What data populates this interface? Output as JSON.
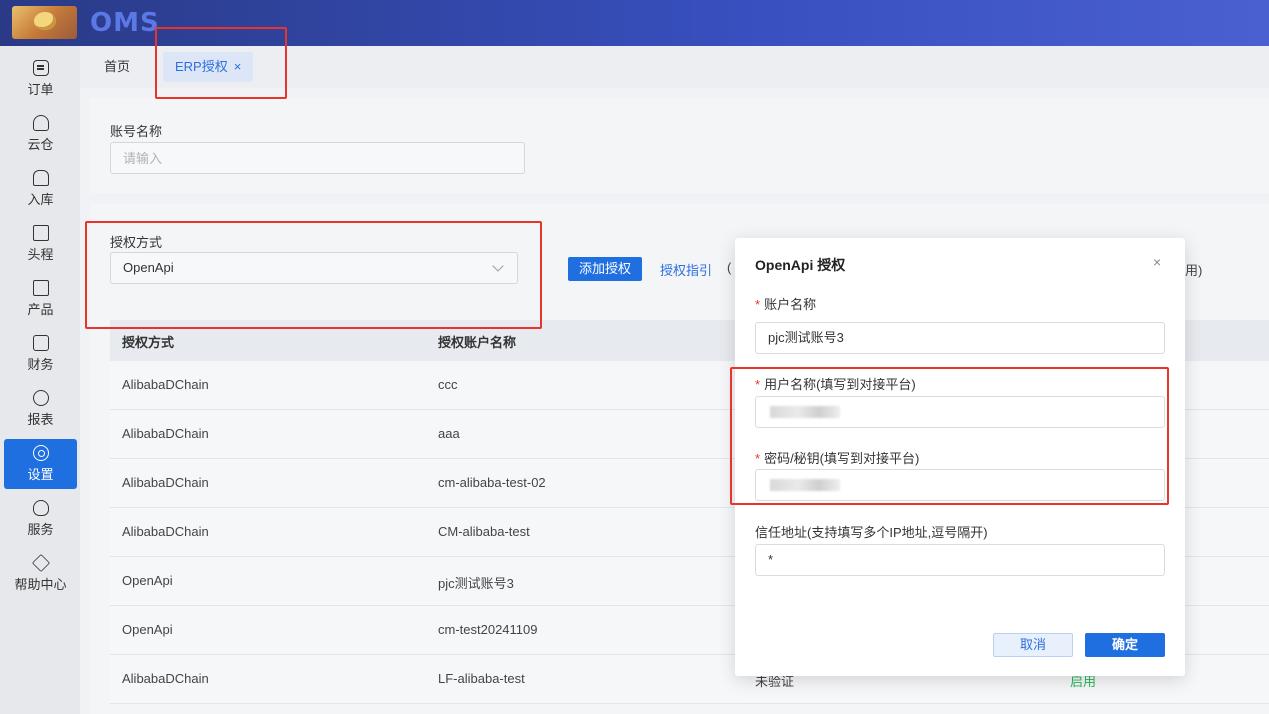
{
  "header": {
    "brand": "OMS"
  },
  "sidebar": {
    "items": [
      {
        "label": "订单",
        "icon": "order-icon"
      },
      {
        "label": "云仓",
        "icon": "cloud-warehouse-icon"
      },
      {
        "label": "入库",
        "icon": "inbound-icon"
      },
      {
        "label": "头程",
        "icon": "truck-icon"
      },
      {
        "label": "产品",
        "icon": "product-icon"
      },
      {
        "label": "财务",
        "icon": "finance-icon"
      },
      {
        "label": "报表",
        "icon": "report-icon"
      },
      {
        "label": "设置",
        "icon": "gear-icon",
        "active": true
      },
      {
        "label": "服务",
        "icon": "service-icon"
      },
      {
        "label": "帮助中心",
        "icon": "help-icon"
      }
    ]
  },
  "tabs": [
    {
      "label": "首页"
    },
    {
      "label": "ERP授权",
      "close": "×"
    }
  ],
  "filter": {
    "account_label": "账号名称",
    "account_placeholder": "请输入",
    "auth_method_label": "授权方式",
    "auth_method_value": "OpenApi"
  },
  "actions": {
    "add_auth": "添加授权",
    "guide": "授权指引",
    "guide_suffix": "(",
    "right_suffix": "用)"
  },
  "table": {
    "headers": [
      "授权方式",
      "授权账户名称"
    ],
    "rows": [
      {
        "method": "AlibabaDChain",
        "account": "ccc"
      },
      {
        "method": "AlibabaDChain",
        "account": "aaa"
      },
      {
        "method": "AlibabaDChain",
        "account": "cm-alibaba-test-02"
      },
      {
        "method": "AlibabaDChain",
        "account": "CM-alibaba-test"
      },
      {
        "method": "OpenApi",
        "account": "pjc测试账号3"
      },
      {
        "method": "OpenApi",
        "account": "cm-test20241109"
      },
      {
        "method": "AlibabaDChain",
        "account": "LF-alibaba-test",
        "status": "未验证",
        "state": "启用"
      }
    ]
  },
  "modal": {
    "title": "OpenApi 授权",
    "close": "×",
    "required_mark": "*",
    "account_label": "账户名称",
    "account_value": "pjc测试账号3",
    "username_label": "用户名称(填写到对接平台)",
    "password_label": "密码/秘钥(填写到对接平台)",
    "trust_label": "信任地址(支持填写多个IP地址,逗号隔开)",
    "trust_value": "*",
    "cancel": "取消",
    "ok": "确定"
  },
  "colors": {
    "primary": "#1f6fe0",
    "highlight": "#e8342c",
    "enabled": "#2bb55a"
  }
}
